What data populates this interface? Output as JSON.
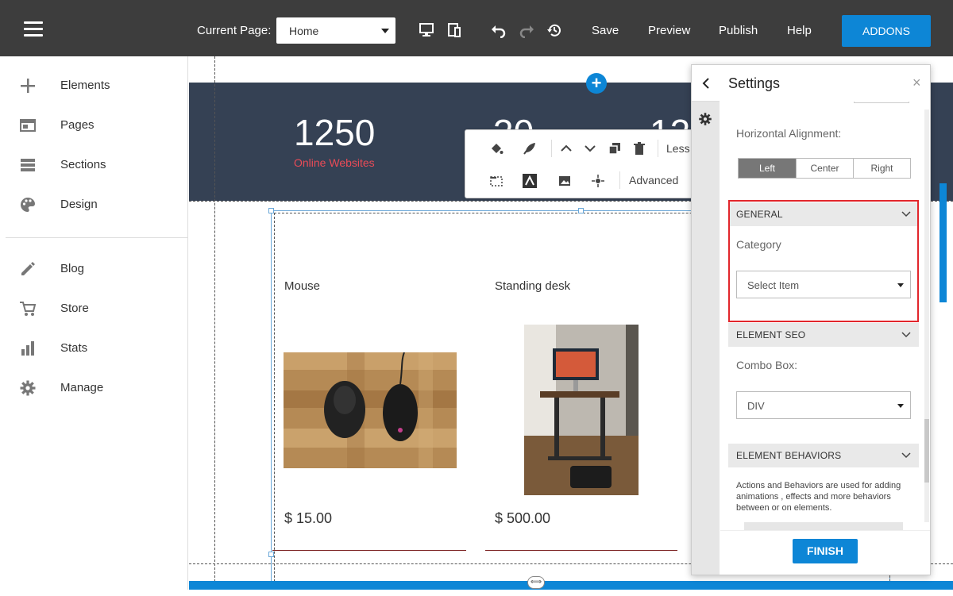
{
  "topbar": {
    "current_page_label": "Current Page:",
    "current_page_value": "Home",
    "save": "Save",
    "preview": "Preview",
    "publish": "Publish",
    "help": "Help",
    "addons": "ADDONS"
  },
  "sidebar": {
    "items": [
      {
        "label": "Elements",
        "icon": "plus-icon"
      },
      {
        "label": "Pages",
        "icon": "pages-icon"
      },
      {
        "label": "Sections",
        "icon": "sections-icon"
      },
      {
        "label": "Design",
        "icon": "palette-icon"
      },
      {
        "label": "Blog",
        "icon": "pencil-icon"
      },
      {
        "label": "Store",
        "icon": "cart-icon"
      },
      {
        "label": "Stats",
        "icon": "stats-icon"
      },
      {
        "label": "Manage",
        "icon": "gear-icon"
      }
    ]
  },
  "canvas": {
    "stats": [
      {
        "number": "1250",
        "label": "Online Websites"
      },
      {
        "number": "30"
      },
      {
        "number": "12"
      }
    ],
    "toolbar": {
      "less": "Less",
      "advanced": "Advanced"
    },
    "products": [
      {
        "name": "Mouse",
        "price": "$ 15.00"
      },
      {
        "name": "Standing desk",
        "price": "$ 500.00"
      }
    ]
  },
  "settings": {
    "title": "Settings",
    "horizontal_alignment": "Horizontal Alignment:",
    "align_options": [
      "Left",
      "Center",
      "Right"
    ],
    "align_selected": "Left",
    "general": "GENERAL",
    "category_label": "Category",
    "category_value": "Select Item",
    "seo": "ELEMENT SEO",
    "combo_label": "Combo Box:",
    "combo_value": "DIV",
    "behaviors": "ELEMENT BEHAVIORS",
    "behaviors_desc": "Actions and Behaviors are used for adding animations , effects and more behaviors between or on elements.",
    "finish": "FINISH"
  },
  "colors": {
    "topbar": "#3d3d3d",
    "accent": "#0d86d6",
    "stats_band": "#354154",
    "stat_label": "#ea4b57",
    "highlight": "#e2262c"
  }
}
